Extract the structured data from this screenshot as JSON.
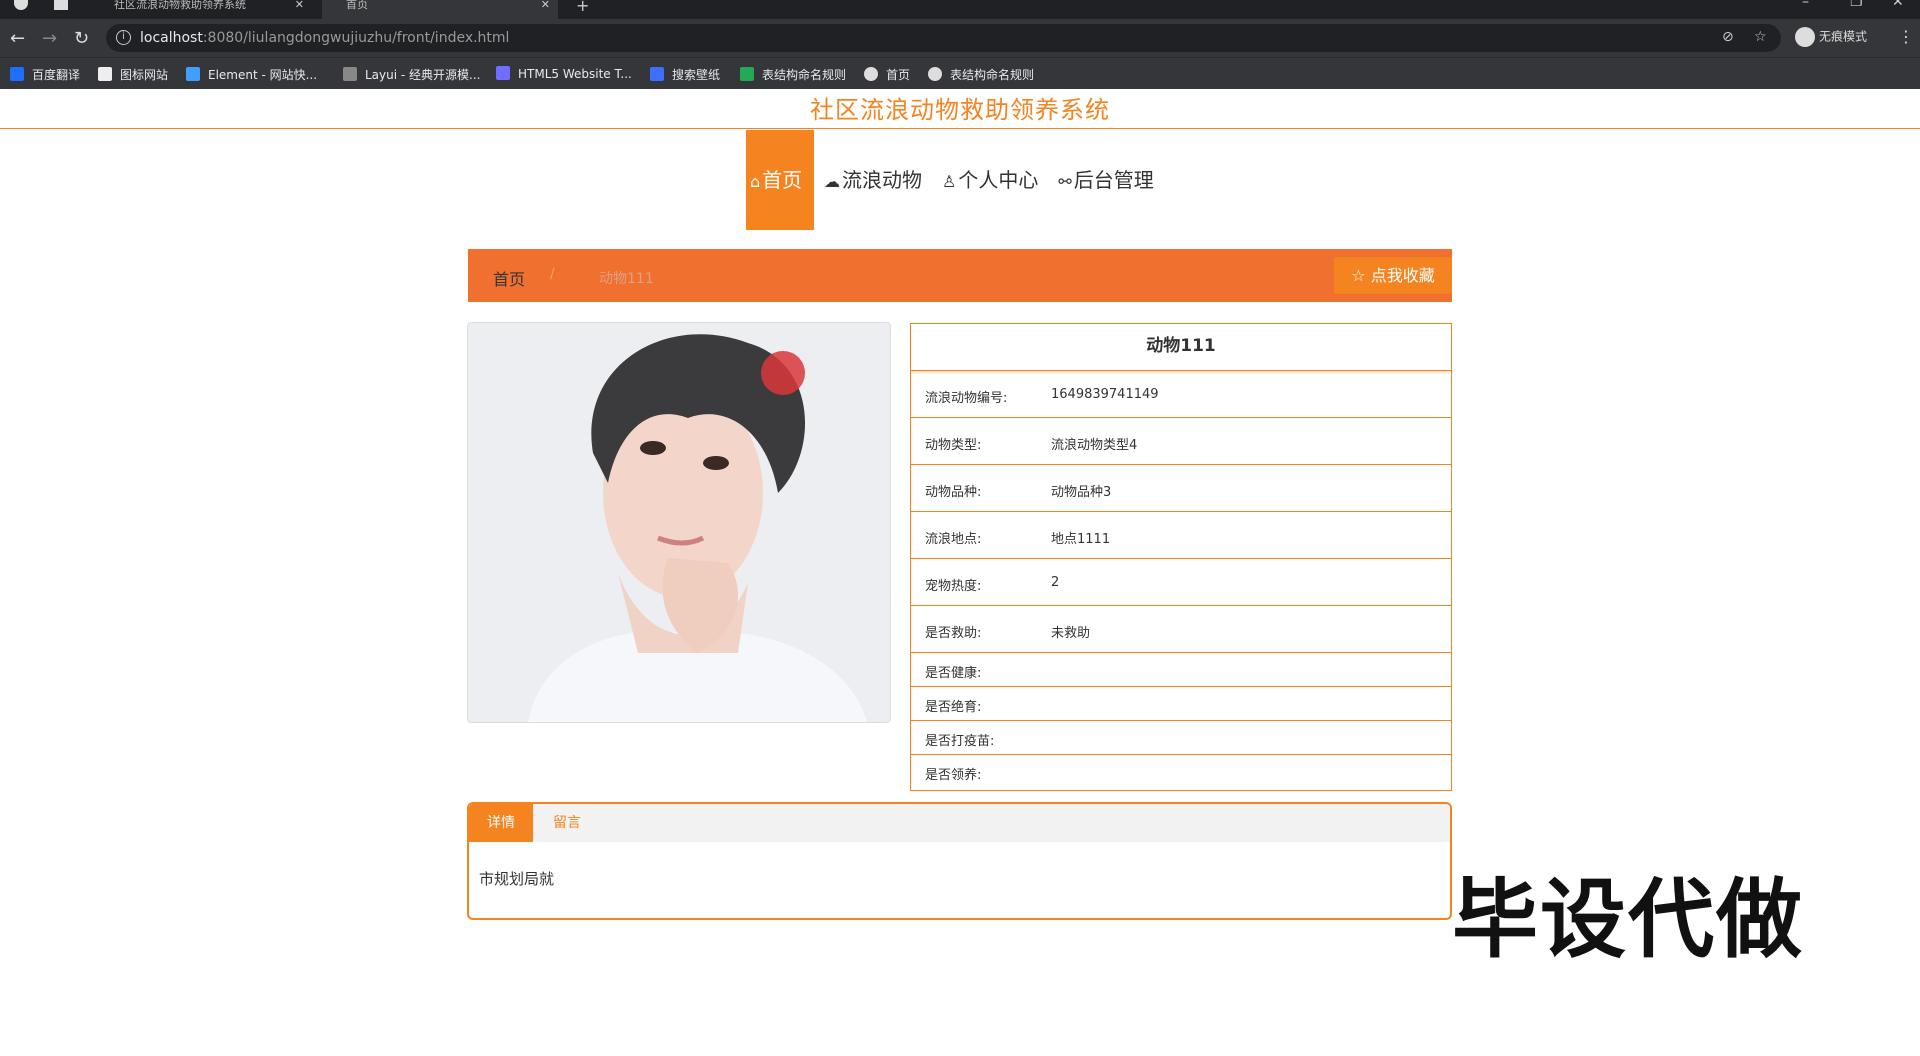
{
  "browser": {
    "tabs": [
      {
        "title": "社区流浪动物救助领养系统"
      },
      {
        "title": "首页"
      }
    ],
    "url_host": "localhost",
    "url_rest": ":8080/liulangdongwujiuzhu/front/index.html",
    "incognito_label": "无痕模式",
    "bookmarks": [
      {
        "label": "百度翻译",
        "color": "#1e6fff"
      },
      {
        "label": "图标网站",
        "color": "#ffffff"
      },
      {
        "label": "Element - 网站快...",
        "color": "#409eff"
      },
      {
        "label": "Layui - 经典开源模...",
        "color": "#cccccc"
      },
      {
        "label": "HTML5 Website T...",
        "color": "#6f6fff"
      },
      {
        "label": "搜索壁纸",
        "color": "#3f6fff"
      },
      {
        "label": "表结构命名规则",
        "color": "#22aa55"
      },
      {
        "label": "首页",
        "color": "#dddddd"
      },
      {
        "label": "表结构命名规则",
        "color": "#dddddd"
      }
    ]
  },
  "site": {
    "title": "社区流浪动物救助领养系统",
    "accent": "#f5831f",
    "nav": [
      {
        "label": "首页",
        "icon": "home-icon",
        "glyph": "⌂"
      },
      {
        "label": "流浪动物",
        "icon": "cloud-icon",
        "glyph": "☁"
      },
      {
        "label": "个人中心",
        "icon": "user-icon",
        "glyph": "♙"
      },
      {
        "label": "后台管理",
        "icon": "link-icon",
        "glyph": "⚯"
      }
    ]
  },
  "breadcrumb": {
    "home": "首页",
    "separator": "/",
    "current": "动物111",
    "favorite": "☆ 点我收藏"
  },
  "animal": {
    "name": "动物111",
    "rows": [
      {
        "key": "流浪动物编号:",
        "value": "1649839741149"
      },
      {
        "key": "动物类型:",
        "value": "流浪动物类型4"
      },
      {
        "key": "动物品种:",
        "value": "动物品种3"
      },
      {
        "key": "流浪地点:",
        "value": "地点1111"
      },
      {
        "key": "宠物热度:",
        "value": "2"
      },
      {
        "key": "是否救助:",
        "value": "未救助"
      },
      {
        "key": "是否健康:",
        "value": ""
      },
      {
        "key": "是否绝育:",
        "value": ""
      },
      {
        "key": "是否打疫苗:",
        "value": ""
      },
      {
        "key": "是否领养:",
        "value": ""
      }
    ]
  },
  "detail_tabs": {
    "tabs": [
      "详情",
      "留言"
    ],
    "content": "市规划局就"
  },
  "watermark": "毕设代做"
}
